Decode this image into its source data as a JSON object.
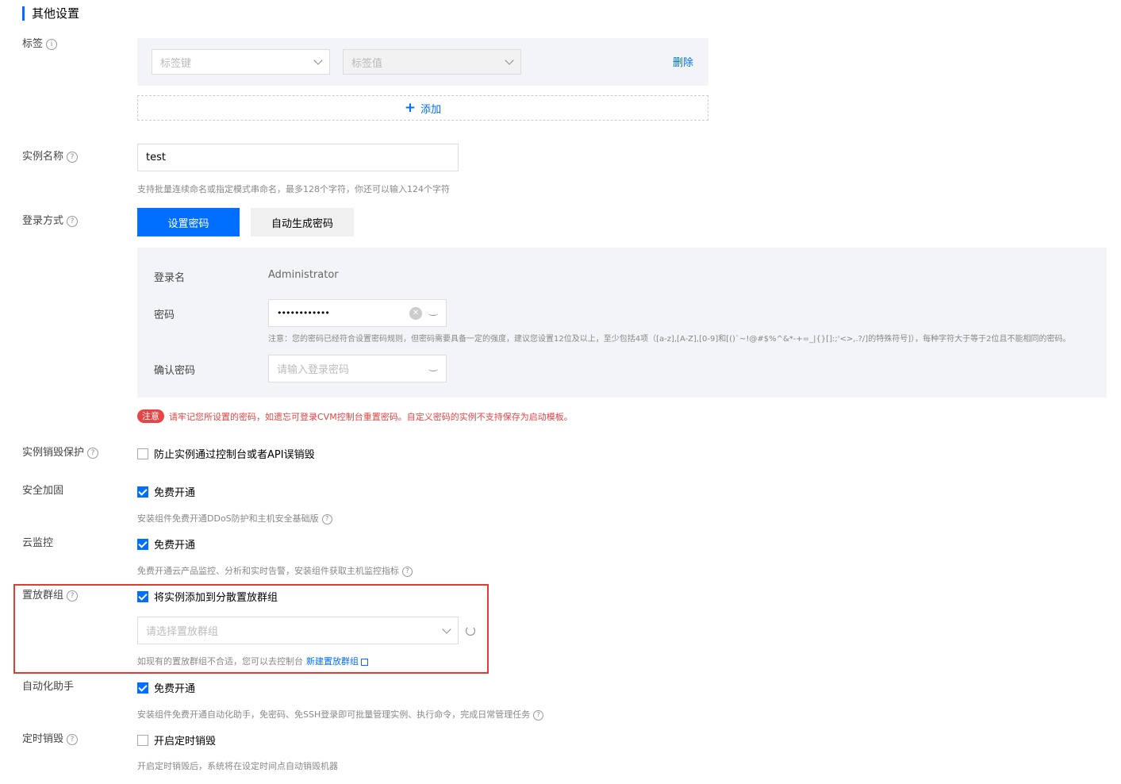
{
  "section": {
    "title": "其他设置"
  },
  "labels": {
    "tag": "标签",
    "instance_name": "实例名称",
    "login_method": "登录方式",
    "destroy_protection": "实例销毁保护",
    "security": "安全加固",
    "monitor": "云监控",
    "placement_group": "置放群组",
    "automation": "自动化助手",
    "scheduled_destroy": "定时销毁"
  },
  "tag": {
    "key_placeholder": "标签键",
    "value_placeholder": "标签值",
    "delete_label": "删除",
    "add_label": "添加"
  },
  "instance_name": {
    "value": "test",
    "hint": "支持批量连续命名或指定模式串命名，最多128个字符，你还可以输入124个字符"
  },
  "login": {
    "set_password_label": "设置密码",
    "auto_password_label": "自动生成密码",
    "username_label": "登录名",
    "username_value": "Administrator",
    "password_label": "密码",
    "password_value": "••••••••••••",
    "password_rule": "注意：您的密码已经符合设置密码规则，但密码需要具备一定的强度，建议您设置12位及以上，至少包括4项（[a-z],[A-Z],[0-9]和[()`~!@#$%^&*-+=_|{}[]:;'<>,.?/]的特殊符号]），每种字符大于等于2位且不能相同的密码。",
    "confirm_label": "确认密码",
    "confirm_placeholder": "请输入登录密码",
    "note_badge": "注意",
    "note_text": "请牢记您所设置的密码，如遗忘可登录CVM控制台重置密码。自定义密码的实例不支持保存为启动模板。"
  },
  "destroy_protection": {
    "checked": false,
    "label": "防止实例通过控制台或者API误销毁"
  },
  "security": {
    "checked": true,
    "label": "免费开通",
    "hint": "安装组件免费开通DDoS防护和主机安全基础版"
  },
  "monitor": {
    "checked": true,
    "label": "免费开通",
    "hint": "免费开通云产品监控、分析和实时告警，安装组件获取主机监控指标"
  },
  "placement": {
    "checked": true,
    "label": "将实例添加到分散置放群组",
    "select_placeholder": "请选择置放群组",
    "hint": "如现有的置放群组不合适，您可以去控制台",
    "create_link": "新建置放群组"
  },
  "automation": {
    "checked": true,
    "label": "免费开通",
    "hint": "安装组件免费开通自动化助手，免密码、免SSH登录即可批量管理实例、执行命令，完成日常管理任务"
  },
  "scheduled_destroy": {
    "checked": false,
    "label": "开启定时销毁",
    "hint": "开启定时销毁后，系统将在设定时间点自动销毁机器"
  },
  "colors": {
    "accent": "#006eff",
    "danger": "#e54545",
    "highlight_frame": "#e53935"
  }
}
